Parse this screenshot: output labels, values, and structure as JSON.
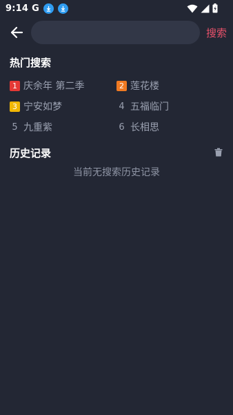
{
  "status_bar": {
    "time": "9:14",
    "g_label": "G",
    "icons": [
      "download-icon",
      "download-icon",
      "wifi-icon",
      "signal-icon",
      "battery-icon"
    ]
  },
  "search": {
    "placeholder": "",
    "value": "",
    "button_label": "搜索",
    "accent_color": "#e8516a"
  },
  "hot_search": {
    "title": "热门搜索",
    "items": [
      {
        "rank": "1",
        "text": "庆余年 第二季",
        "badge_color": "#e53935"
      },
      {
        "rank": "2",
        "text": "莲花楼",
        "badge_color": "#f07a22"
      },
      {
        "rank": "3",
        "text": "宁安如梦",
        "badge_color": "#f2b705"
      },
      {
        "rank": "4",
        "text": "五福临门",
        "badge_color": ""
      },
      {
        "rank": "5",
        "text": "九重紫",
        "badge_color": ""
      },
      {
        "rank": "6",
        "text": "长相思",
        "badge_color": ""
      }
    ]
  },
  "history": {
    "title": "历史记录",
    "empty_text": "当前无搜索历史记录",
    "clear_icon": "trash-icon"
  },
  "colors": {
    "background": "#232734",
    "input_background": "#323747",
    "muted_text": "#9aa0b0"
  }
}
